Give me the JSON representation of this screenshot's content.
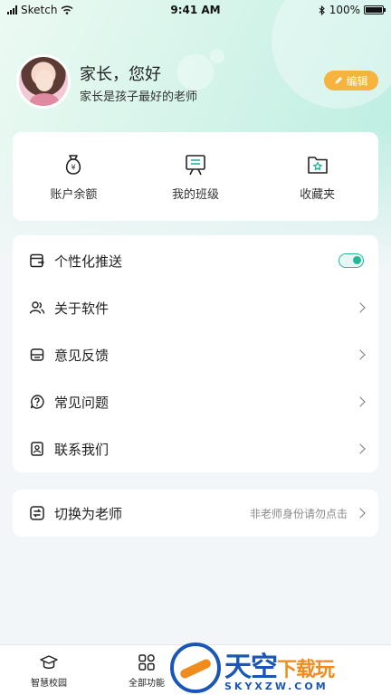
{
  "status_bar": {
    "carrier": "Sketch",
    "time": "9:41 AM",
    "battery": "100%"
  },
  "profile": {
    "greeting": "家长，您好",
    "subtitle": "家长是孩子最好的老师",
    "edit_label": "编辑"
  },
  "quick_actions": [
    {
      "label": "账户余额",
      "icon": "money-bag-icon"
    },
    {
      "label": "我的班级",
      "icon": "class-board-icon"
    },
    {
      "label": "收藏夹",
      "icon": "favorites-folder-icon"
    }
  ],
  "menu": [
    {
      "label": "个性化推送",
      "icon": "push-icon",
      "toggle_on": true
    },
    {
      "label": "关于软件",
      "icon": "users-icon"
    },
    {
      "label": "意见反馈",
      "icon": "feedback-icon"
    },
    {
      "label": "常见问题",
      "icon": "question-icon"
    },
    {
      "label": "联系我们",
      "icon": "contact-icon"
    }
  ],
  "switch_role": {
    "label": "切换为老师",
    "hint": "非老师身份请勿点击",
    "icon": "switch-icon"
  },
  "tabs": [
    {
      "label": "智慧校园",
      "icon": "campus-icon"
    },
    {
      "label": "全部功能",
      "icon": "grid-icon"
    }
  ],
  "watermark": {
    "cn_main": "天空",
    "cn_sub": "下载玩",
    "en": "SKYXZW.COM"
  },
  "colors": {
    "accent": "#28b49a",
    "edit_button": "#f6b33e",
    "watermark_blue": "#1a56b8",
    "watermark_orange": "#f08c1e"
  }
}
